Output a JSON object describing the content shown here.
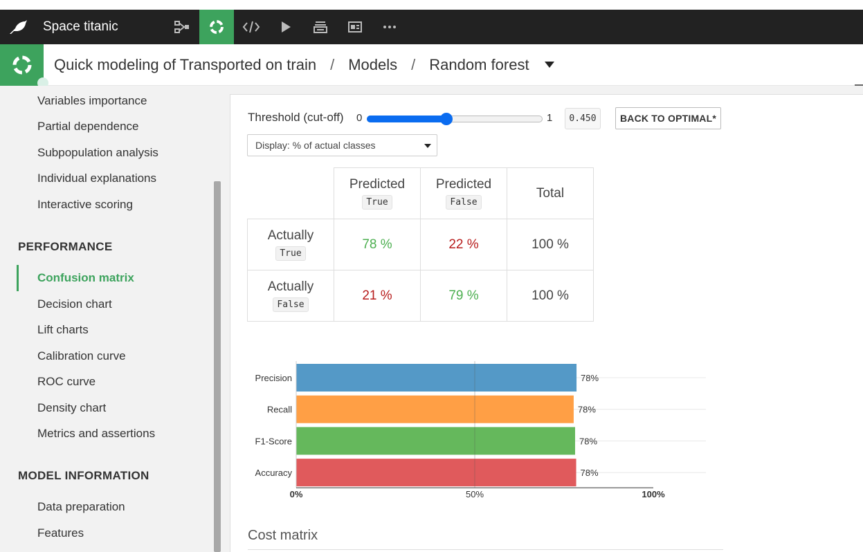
{
  "navbar": {
    "project_name": "Space titanic",
    "icons": [
      "bird-logo-icon",
      "flow-icon",
      "lab-icon",
      "code-icon",
      "play-icon",
      "stack-icon",
      "dashboard-icon",
      "more-icon"
    ]
  },
  "breadcrumb": {
    "analysis": "Quick modeling of Transported on train",
    "sep1": "/",
    "models": "Models",
    "sep2": "/",
    "model": "Random forest"
  },
  "sidebar": {
    "items_top": [
      "Variables importance",
      "Partial dependence",
      "Subpopulation analysis",
      "Individual explanations",
      "Interactive scoring"
    ],
    "performance_heading": "PERFORMANCE",
    "performance_items": [
      "Confusion matrix",
      "Decision chart",
      "Lift charts",
      "Calibration curve",
      "ROC curve",
      "Density chart",
      "Metrics and assertions"
    ],
    "model_info_heading": "MODEL INFORMATION",
    "model_info_items": [
      "Data preparation",
      "Features"
    ]
  },
  "threshold": {
    "label": "Threshold (cut-off)",
    "min": "0",
    "max": "1",
    "value": "0.450",
    "fraction": 0.45,
    "back_button": "BACK TO OPTIMAL*"
  },
  "display_select": {
    "value": "Display: % of actual classes"
  },
  "confusion_matrix": {
    "col_headers": [
      {
        "label": "Predicted",
        "code": "True"
      },
      {
        "label": "Predicted",
        "code": "False"
      },
      {
        "label": "Total",
        "code": ""
      }
    ],
    "rows": [
      {
        "label": "Actually",
        "code": "True",
        "cells": [
          "78 %",
          "22 %",
          "100 %"
        ]
      },
      {
        "label": "Actually",
        "code": "False",
        "cells": [
          "21 %",
          "79 %",
          "100 %"
        ]
      }
    ],
    "colors": {
      "correct": "#4caf50",
      "incorrect": "#b71c1c"
    }
  },
  "chart_data": {
    "type": "bar",
    "orientation": "horizontal",
    "categories": [
      "Precision",
      "Recall",
      "F1-Score",
      "Accuracy"
    ],
    "values": [
      78.5,
      77.7,
      78.1,
      78.4
    ],
    "data_labels": [
      "78%",
      "78%",
      "78%",
      "78%"
    ],
    "colors": [
      "#5499c7",
      "#ff9f45",
      "#65b85c",
      "#e05a5c"
    ],
    "xlim": [
      0,
      100
    ],
    "x_ticks": [
      "0%",
      "50%",
      "100%"
    ],
    "x_tick_values": [
      0,
      50,
      100
    ],
    "grid": true,
    "title": "",
    "xlabel": "",
    "ylabel": ""
  },
  "cost_matrix": {
    "title": "Cost matrix"
  },
  "accent_color": "#3da35d"
}
